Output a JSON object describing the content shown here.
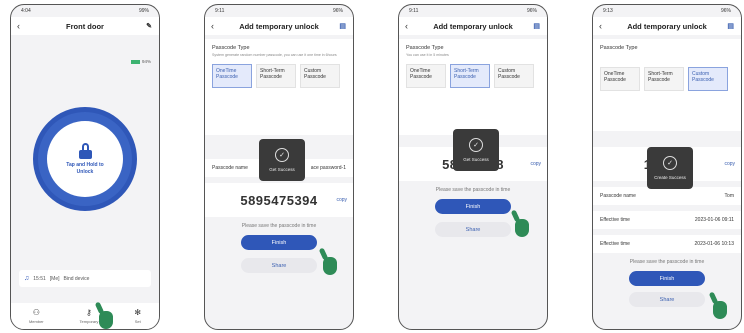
{
  "p1": {
    "time": "4:04",
    "battery_status": "99%",
    "title": "Front door",
    "lock_battery": "94%",
    "unlock_text": "Tap and Hold to Unlock",
    "log_time": "15:51",
    "log_user": "[Me]",
    "log_action": "Bind device",
    "nav": [
      "Member",
      "Temporary",
      "Set"
    ]
  },
  "p2": {
    "time": "9:11",
    "battery_status": "96%",
    "title": "Add temporary unlock",
    "type_label": "Passcode Type",
    "type_desc": "System generate random number passcode, you can use it one time in 6hours",
    "opts": [
      "OneTime Passcode",
      "Short-Term Passcode",
      "Custom Passcode"
    ],
    "name_label": "Passcode name",
    "name_value": "ace password-1",
    "code": "5895475394",
    "copy": "copy",
    "note": "Please save the passcode in time",
    "finish": "Finish",
    "share": "Share",
    "toast": "Get Success"
  },
  "p3": {
    "time": "9:11",
    "battery_status": "96%",
    "title": "Add temporary unlock",
    "type_label": "Passcode Type",
    "type_desc": "You can use it in 5 minutes",
    "opts": [
      "OneTime Passcode",
      "Short-Term Passcode",
      "Custom Passcode"
    ],
    "code": "58618018",
    "copy": "copy",
    "note": "Please save the passcode in time",
    "finish": "Finish",
    "share": "Share",
    "toast": "Get Success"
  },
  "p4": {
    "time": "9:13",
    "battery_status": "96%",
    "title": "Add temporary unlock",
    "type_label": "Passcode Type",
    "opts": [
      "OneTime Passcode",
      "Short-Term Passcode",
      "Custom Passcode"
    ],
    "code": "187161",
    "copy": "copy",
    "name_label": "Passcode name",
    "name_value": "Tom",
    "eff_label": "Effective time",
    "eff_value": "2023-01-06 09:11",
    "exp_label": "Effective time",
    "exp_value": "2023-01-06 10:13",
    "note": "Please save the passcode in time",
    "finish": "Finish",
    "share": "Share",
    "toast": "Create Success"
  }
}
